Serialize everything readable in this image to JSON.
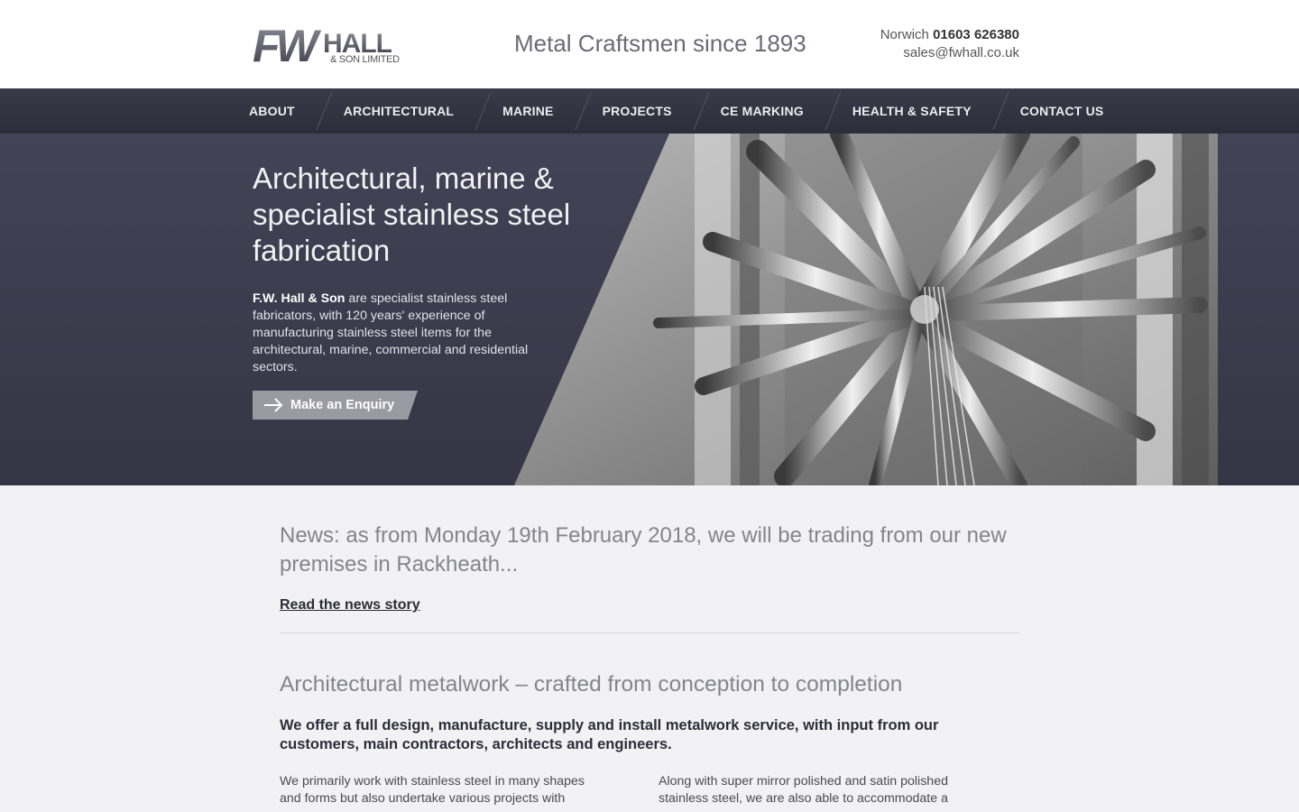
{
  "header": {
    "logo_text": "FWHALL",
    "logo_subtext": "& SON LIMITED",
    "tagline": "Metal Craftsmen since 1893",
    "city": "Norwich",
    "phone": "01603 626380",
    "email": "sales@fwhall.co.uk"
  },
  "nav": {
    "items": [
      "ABOUT",
      "ARCHITECTURAL",
      "MARINE",
      "PROJECTS",
      "CE MARKING",
      "HEALTH & SAFETY",
      "CONTACT US"
    ]
  },
  "hero": {
    "title": "Architectural, marine & specialist stainless steel fabrication",
    "body_bold": "F.W. Hall & Son",
    "body_rest": " are specialist stainless steel fabricators, with 120 years' experience of manufacturing stainless steel items for the architectural, marine, commercial and residential sectors.",
    "button_label": "Make an Enquiry"
  },
  "news": {
    "title": "News: as from Monday 19th February 2018, we will be trading from our new premises in Rackheath...",
    "link": "Read the news story"
  },
  "section": {
    "title": "Architectural metalwork – crafted from conception to completion",
    "lead": "We offer a full design, manufacture, supply and install metalwork service, with input from our customers, main contractors, architects and engineers.",
    "col1": "We primarily work with stainless steel in many shapes and forms but also undertake various projects with",
    "col2": "Along with super mirror polished and satin polished stainless steel, we are also able to accommodate a"
  },
  "colors": {
    "nav_bg": "#33333f",
    "hero_bg": "#3f3f51",
    "page_bg": "#f2f2f4",
    "button_bg": "#9a9aa2"
  }
}
